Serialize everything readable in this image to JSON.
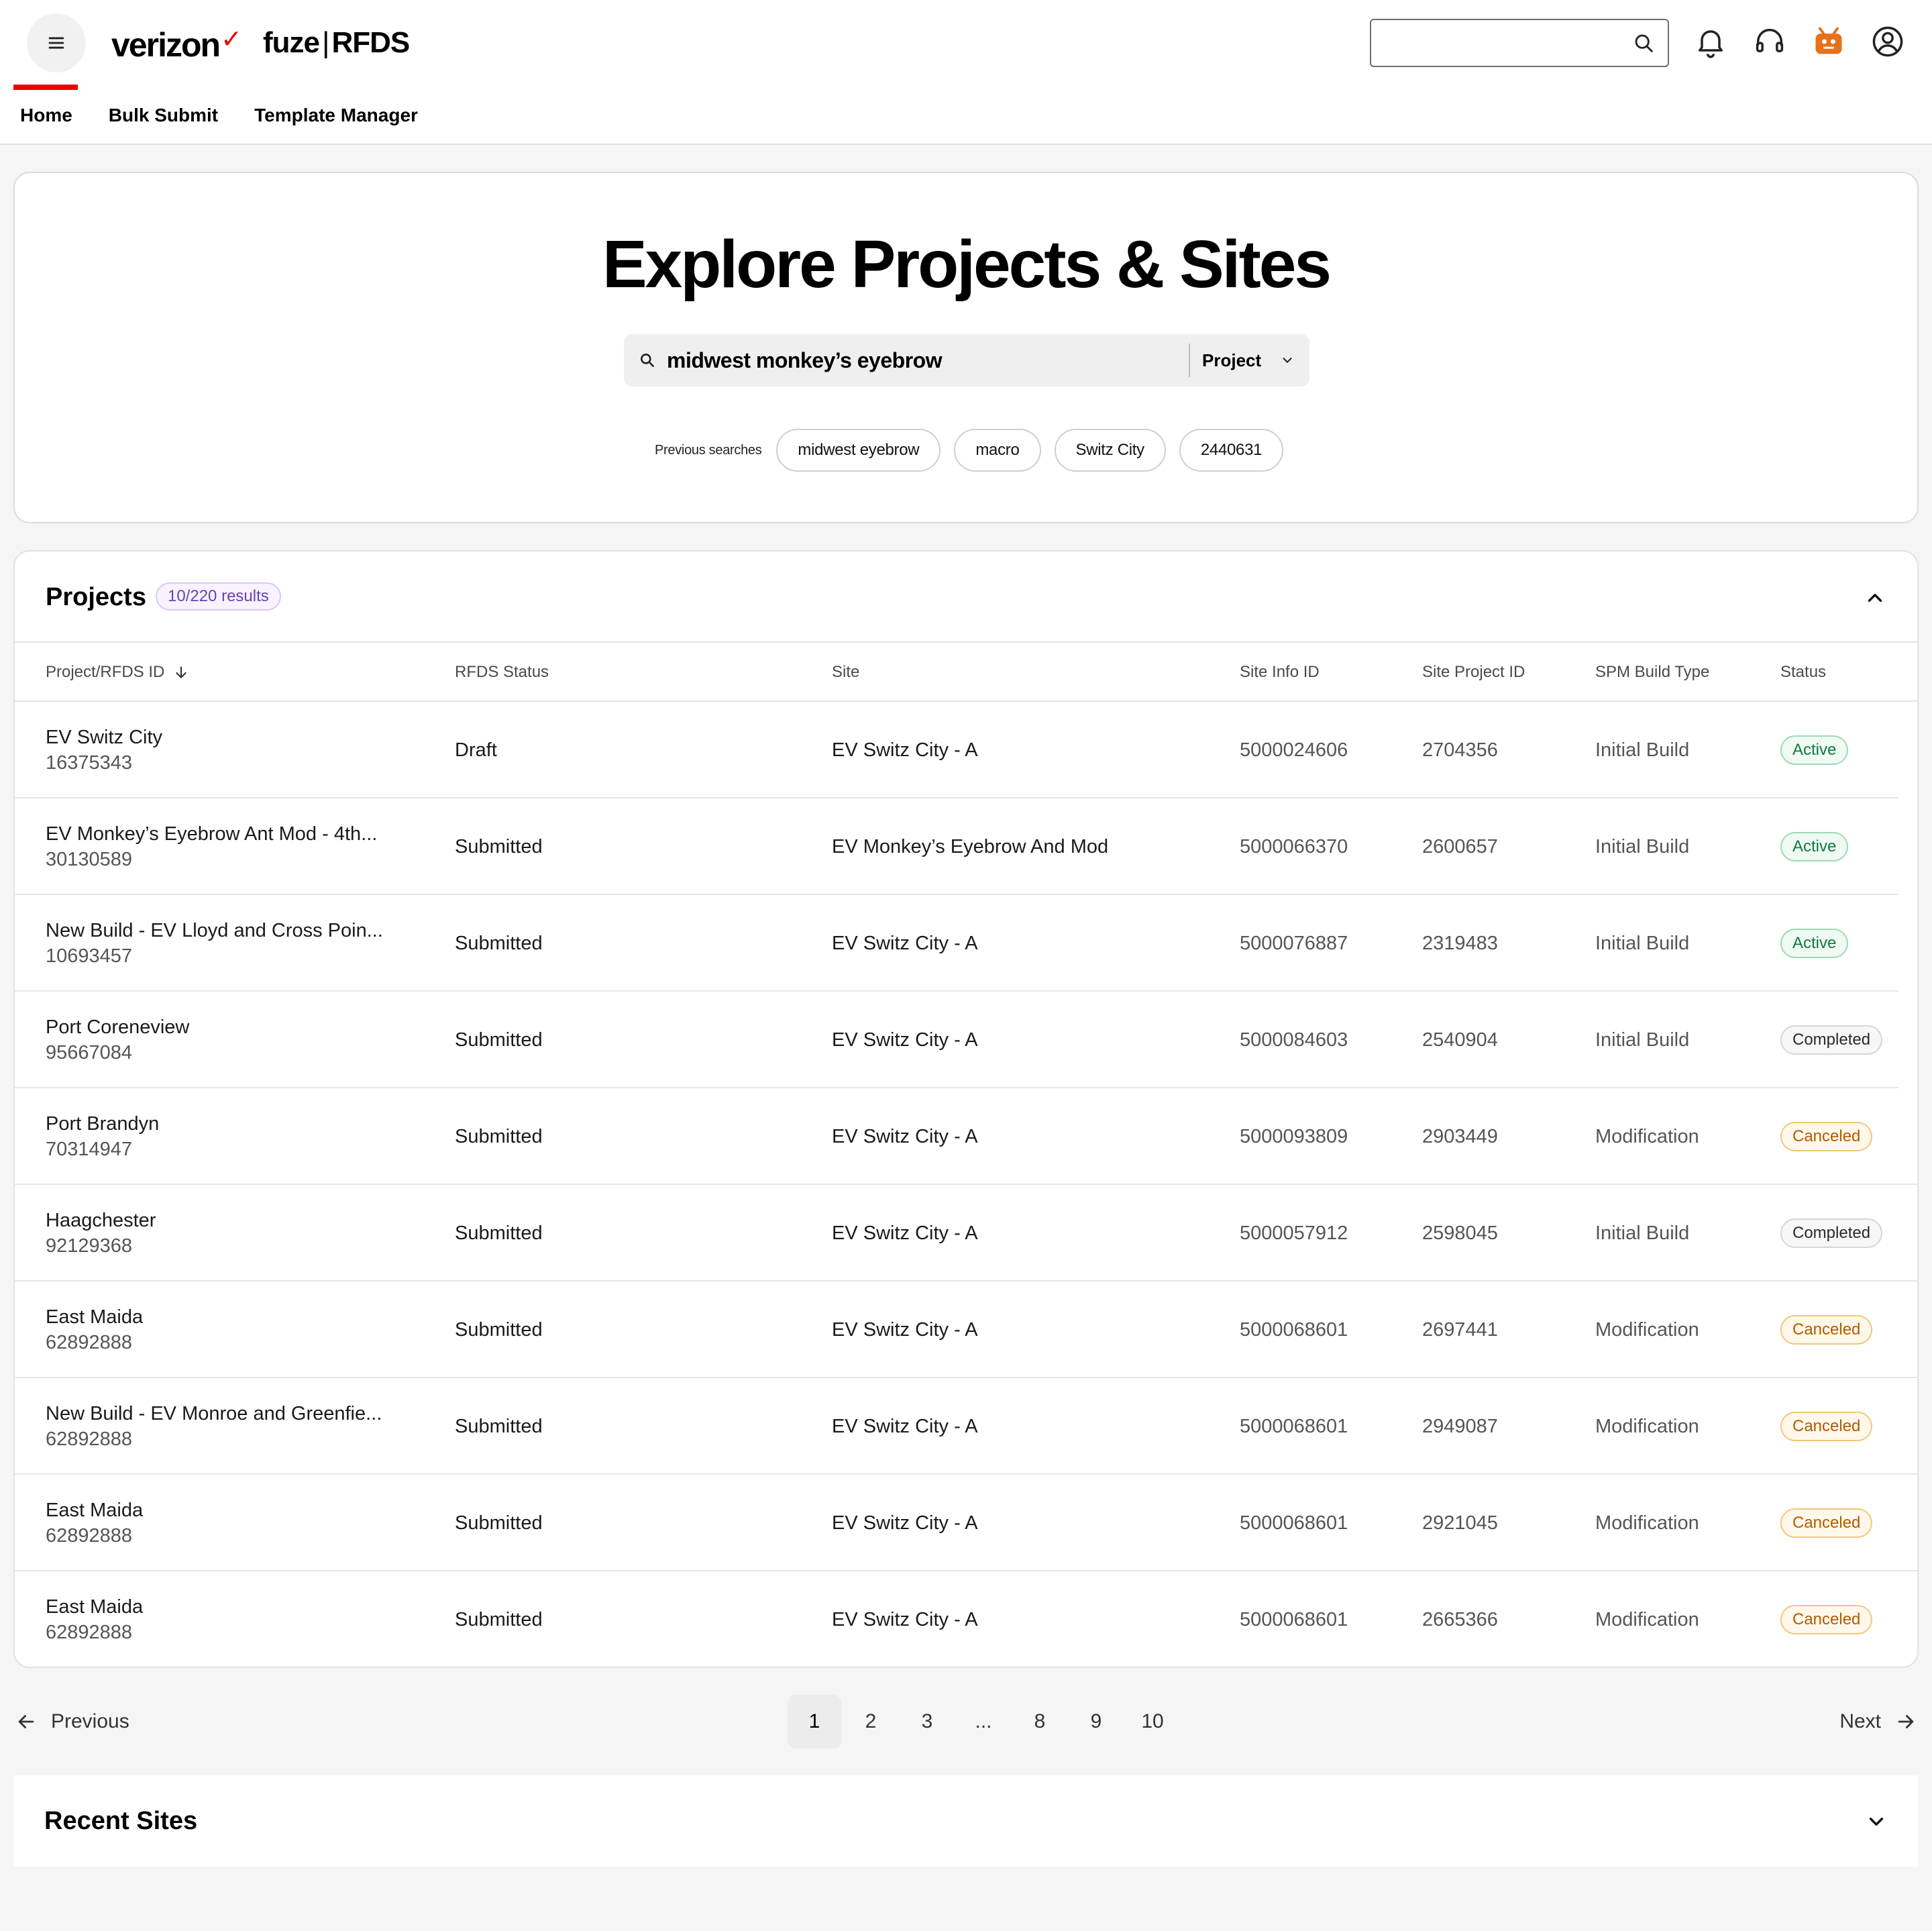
{
  "header": {
    "brand": "verizon",
    "product_left": "fuze",
    "product_sep": "|",
    "product_right": "RFDS",
    "search_placeholder": "",
    "icons": [
      "menu-icon",
      "search-icon",
      "bell-icon",
      "headset-icon",
      "assistant-bot-icon",
      "account-icon"
    ]
  },
  "nav": {
    "items": [
      {
        "label": "Home",
        "active": true
      },
      {
        "label": "Bulk Submit",
        "active": false
      },
      {
        "label": "Template Manager",
        "active": false
      }
    ]
  },
  "hero": {
    "title": "Explore Projects & Sites",
    "search_value": "midwest monkey’s eyebrow",
    "scope_selected": "Project",
    "previous_label": "Previous searches",
    "previous_searches": [
      "midwest eyebrow",
      "macro",
      "Switz City",
      "2440631"
    ]
  },
  "projects": {
    "title": "Projects",
    "results": "10/220 results",
    "columns": [
      "Project/RFDS ID",
      "RFDS Status",
      "Site",
      "Site Info ID",
      "Site Project ID",
      "SPM Build Type",
      "Status"
    ],
    "rows": [
      {
        "name": "EV Switz City",
        "id": "16375343",
        "rfds_status": "Draft",
        "site": "EV Switz City - A",
        "site_info_id": "5000024606",
        "site_project_id": "2704356",
        "build_type": "Initial Build",
        "status": "Active"
      },
      {
        "name": "EV Monkey’s Eyebrow Ant Mod - 4th...",
        "id": "30130589",
        "rfds_status": "Submitted",
        "site": "EV Monkey’s Eyebrow And Mod",
        "site_info_id": "5000066370",
        "site_project_id": "2600657",
        "build_type": "Initial Build",
        "status": "Active"
      },
      {
        "name": "New Build - EV Lloyd and Cross Poin...",
        "id": "10693457",
        "rfds_status": "Submitted",
        "site": "EV Switz City - A",
        "site_info_id": "5000076887",
        "site_project_id": "2319483",
        "build_type": "Initial Build",
        "status": "Active"
      },
      {
        "name": "Port Coreneview",
        "id": "95667084",
        "rfds_status": "Submitted",
        "site": "EV Switz City - A",
        "site_info_id": "5000084603",
        "site_project_id": "2540904",
        "build_type": "Initial Build",
        "status": "Completed"
      },
      {
        "name": "Port Brandyn",
        "id": "70314947",
        "rfds_status": "Submitted",
        "site": "EV Switz City - A",
        "site_info_id": "5000093809",
        "site_project_id": "2903449",
        "build_type": "Modification",
        "status": "Canceled"
      },
      {
        "name": "Haagchester",
        "id": "92129368",
        "rfds_status": "Submitted",
        "site": "EV Switz City - A",
        "site_info_id": "5000057912",
        "site_project_id": "2598045",
        "build_type": "Initial Build",
        "status": "Completed"
      },
      {
        "name": "East Maida",
        "id": "62892888",
        "rfds_status": "Submitted",
        "site": "EV Switz City - A",
        "site_info_id": "5000068601",
        "site_project_id": "2697441",
        "build_type": "Modification",
        "status": "Canceled"
      },
      {
        "name": "New Build - EV Monroe and Greenfie...",
        "id": "62892888",
        "rfds_status": "Submitted",
        "site": "EV Switz City - A",
        "site_info_id": "5000068601",
        "site_project_id": "2949087",
        "build_type": "Modification",
        "status": "Canceled"
      },
      {
        "name": "East Maida",
        "id": "62892888",
        "rfds_status": "Submitted",
        "site": "EV Switz City - A",
        "site_info_id": "5000068601",
        "site_project_id": "2921045",
        "build_type": "Modification",
        "status": "Canceled"
      },
      {
        "name": "East Maida",
        "id": "62892888",
        "rfds_status": "Submitted",
        "site": "EV Switz City - A",
        "site_info_id": "5000068601",
        "site_project_id": "2665366",
        "build_type": "Modification",
        "status": "Canceled"
      }
    ]
  },
  "pagination": {
    "previous": "Previous",
    "next": "Next",
    "pages": [
      "1",
      "2",
      "3",
      "...",
      "8",
      "9",
      "10"
    ],
    "current": "1"
  },
  "recent_sites": {
    "title": "Recent Sites"
  },
  "colors": {
    "brand_red": "#ee0000",
    "active": "#117a3d",
    "completed": "#2a2a2a",
    "canceled": "#b35a00",
    "results_badge": "#6b3fb8"
  }
}
